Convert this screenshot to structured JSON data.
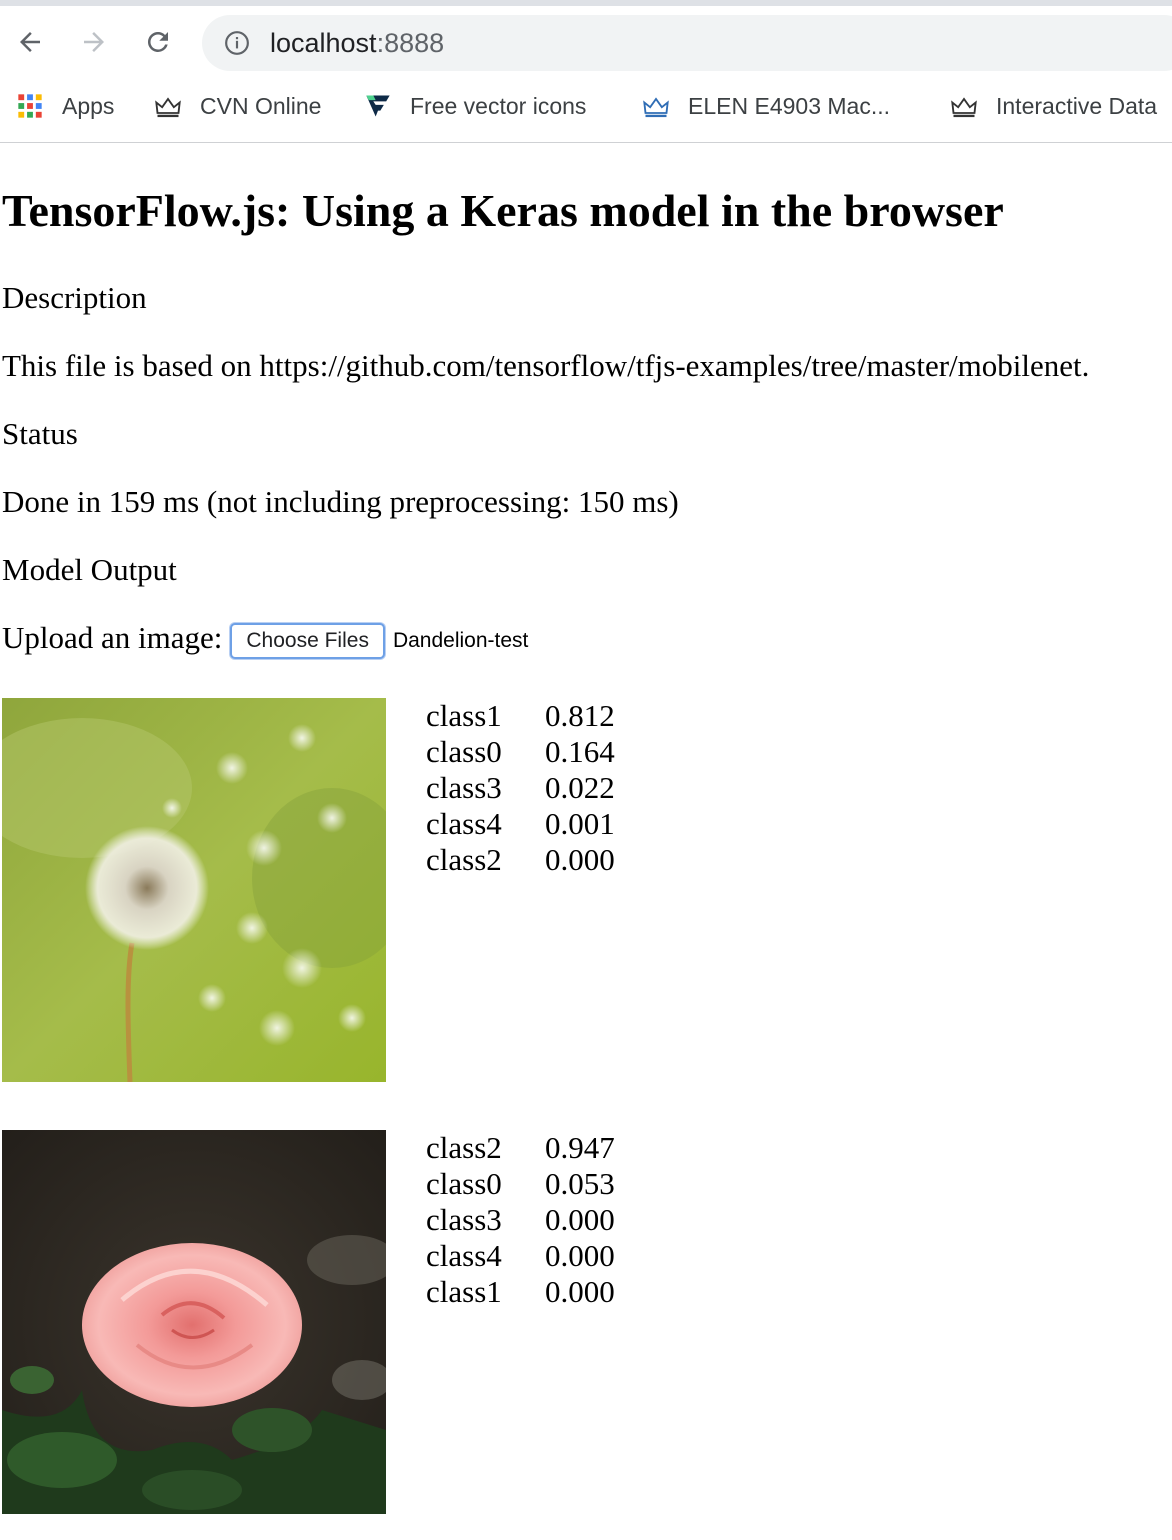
{
  "browser": {
    "url_host": "localhost",
    "url_port": ":8888",
    "bookmarks": [
      {
        "label": "Apps",
        "icon": "apps-grid-icon"
      },
      {
        "label": "CVN Online",
        "icon": "crown-icon"
      },
      {
        "label": "Free vector icons",
        "icon": "flaticon-logo-icon"
      },
      {
        "label": "ELEN E4903 Mac...",
        "icon": "crown-icon"
      },
      {
        "label": "Interactive Data",
        "icon": "crown-icon"
      }
    ]
  },
  "page": {
    "title": "TensorFlow.js: Using a Keras model in the browser",
    "description_heading": "Description",
    "description_text": "This file is based on https://github.com/tensorflow/tfjs-examples/tree/master/mobilenet.",
    "status_heading": "Status",
    "status_text": "Done in 159 ms (not including preprocessing: 150 ms)",
    "output_heading": "Model Output",
    "upload_label": "Upload an image:",
    "choose_files_label": "Choose Files",
    "selected_file": "Dandelion-test"
  },
  "predictions": [
    {
      "image": "dandelion-image",
      "rows": [
        {
          "class": "class1",
          "prob": "0.812"
        },
        {
          "class": "class0",
          "prob": "0.164"
        },
        {
          "class": "class3",
          "prob": "0.022"
        },
        {
          "class": "class4",
          "prob": "0.001"
        },
        {
          "class": "class2",
          "prob": "0.000"
        }
      ]
    },
    {
      "image": "rose-image",
      "rows": [
        {
          "class": "class2",
          "prob": "0.947"
        },
        {
          "class": "class0",
          "prob": "0.053"
        },
        {
          "class": "class3",
          "prob": "0.000"
        },
        {
          "class": "class4",
          "prob": "0.000"
        },
        {
          "class": "class1",
          "prob": "0.000"
        }
      ]
    }
  ]
}
